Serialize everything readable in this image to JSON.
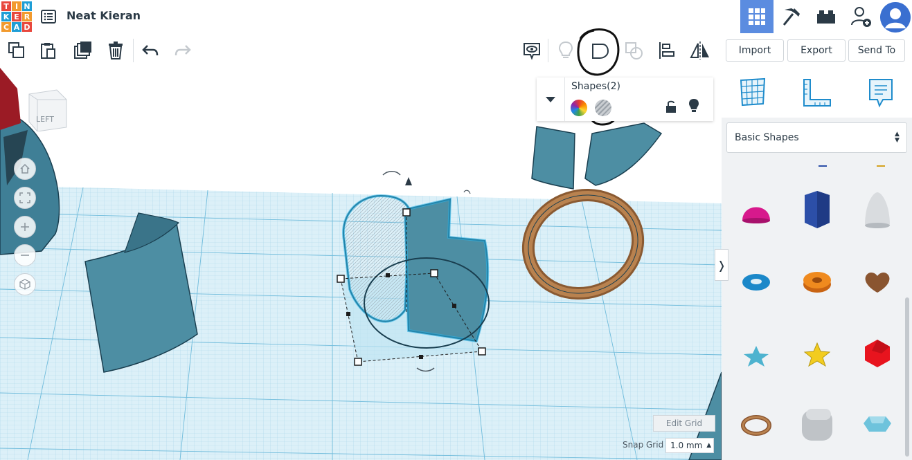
{
  "app": {
    "logo_letters": [
      "T",
      "I",
      "N",
      "K",
      "E",
      "R",
      "C",
      "A",
      "D"
    ],
    "project_title": "Neat Kieran"
  },
  "toolbar": {
    "import_label": "Import",
    "export_label": "Export",
    "send_to_label": "Send To"
  },
  "inspector": {
    "title": "Shapes(2)"
  },
  "viewcube": {
    "face_label": "LEFT"
  },
  "workplane": {
    "edit_grid_label": "Edit Grid",
    "snap_grid_label": "Snap Grid",
    "snap_grid_value": "1.0 mm"
  },
  "library": {
    "selected": "Basic Shapes"
  },
  "colors": {
    "accent": "#5b8ce0",
    "shape_teal": "#4d8ea3",
    "selection_blue": "#2ab3e6"
  }
}
